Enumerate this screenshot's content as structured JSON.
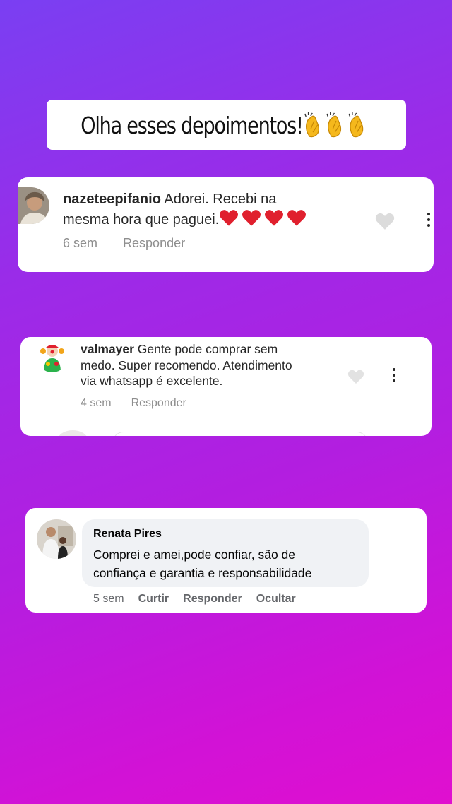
{
  "title": "Olha esses depoimentos!",
  "title_emoji": "clapping-hands x3",
  "comments": [
    {
      "username": "nazeteepifanio",
      "line1": "Adorei. Recebi na",
      "line2": "mesma hora que paguei.",
      "hearts": "4 red hearts",
      "time": "6 sem",
      "reply": "Responder"
    },
    {
      "username": "valmayer",
      "line1": "Gente pode comprar sem",
      "line2": "medo. Super recomendo. Atendimento",
      "line3": "via whatsapp é excelente.",
      "time": "4 sem",
      "reply": "Responder"
    },
    {
      "name": "Renata Pires",
      "line1": "Comprei e amei,pode confiar, são de",
      "line2": "confiança e garantia e responsabilidade",
      "time": "5 sem",
      "like": "Curtir",
      "reply": "Responder",
      "hide": "Ocultar"
    }
  ],
  "colors": {
    "gradient_start": "#7a3ff2",
    "gradient_end": "#e00fcf",
    "heart_red": "#e0202e"
  }
}
